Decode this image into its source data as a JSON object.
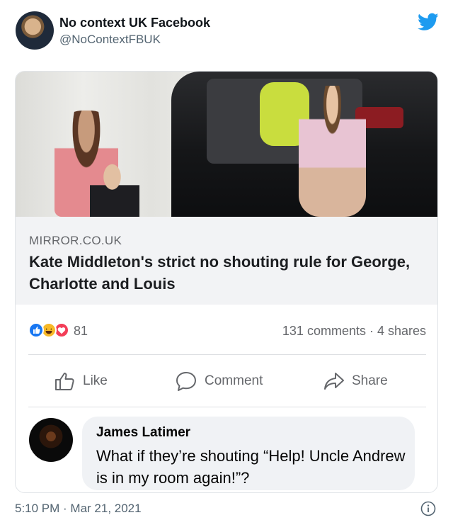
{
  "tweet": {
    "display_name": "No context UK Facebook",
    "handle": "@NoContextFBUK",
    "timestamp": "5:10 PM · Mar 21, 2021",
    "brand_color": "#1d9bf0"
  },
  "facebook_post": {
    "link": {
      "domain": "MIRROR.CO.UK",
      "title": "Kate Middleton's strict no shouting rule for George, Charlotte and Louis"
    },
    "reactions": {
      "icons": [
        "like-icon",
        "haha-icon",
        "love-icon"
      ],
      "count": "81"
    },
    "stats": "131 comments · 4 shares",
    "actions": {
      "like": "Like",
      "comment": "Comment",
      "share": "Share"
    },
    "comment": {
      "author": "James Latimer",
      "text": "What if they’re shouting “Help! Uncle Andrew is in my room again!”?"
    }
  }
}
